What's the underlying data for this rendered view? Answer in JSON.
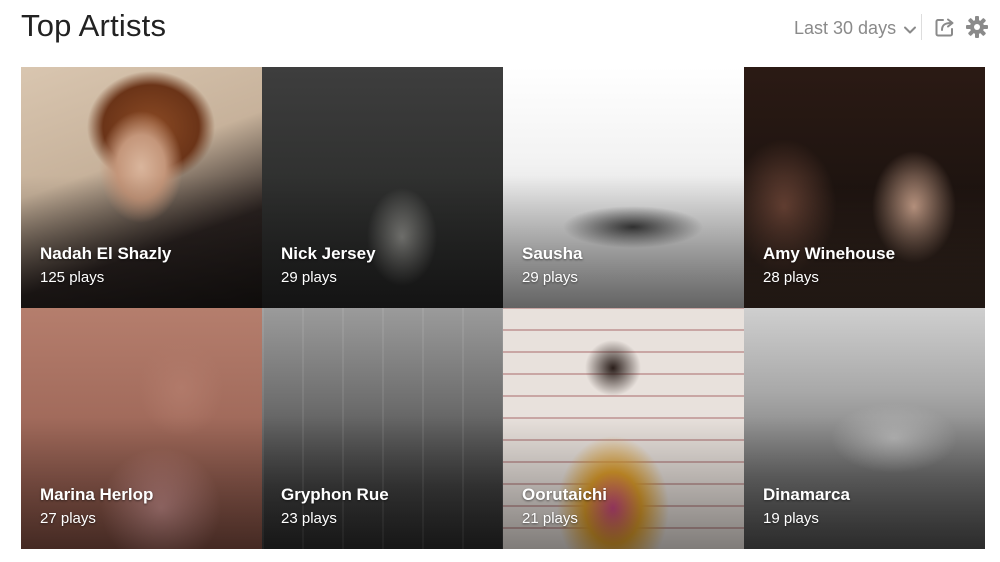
{
  "header": {
    "title": "Top Artists",
    "range_label": "Last 30 days"
  },
  "icons": {
    "range": "chevron-down-icon",
    "share": "share-icon",
    "settings": "gear-icon"
  },
  "artists": [
    {
      "name": "Nadah El Shazly",
      "plays": "125 plays"
    },
    {
      "name": "Nick Jersey",
      "plays": "29 plays"
    },
    {
      "name": "Sausha",
      "plays": "29 plays"
    },
    {
      "name": "Amy Winehouse",
      "plays": "28 plays"
    },
    {
      "name": "Marina Herlop",
      "plays": "27 plays"
    },
    {
      "name": "Gryphon Rue",
      "plays": "23 plays"
    },
    {
      "name": "Oorutaichi",
      "plays": "21 plays"
    },
    {
      "name": "Dinamarca",
      "plays": "19 plays"
    }
  ],
  "colors": {
    "title": "#222222",
    "muted": "#8a8a8a"
  }
}
